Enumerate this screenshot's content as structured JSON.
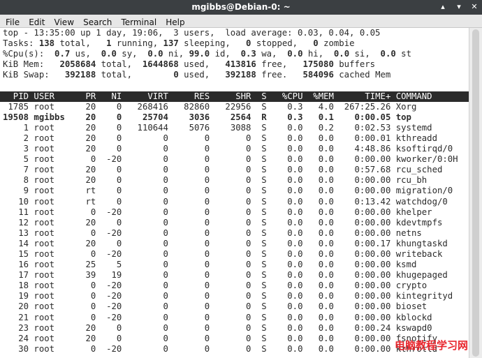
{
  "window": {
    "title": "mgibbs@Debian-0: ~",
    "buttons": {
      "minimize": "▴",
      "maximize": "▾",
      "close": "✕"
    }
  },
  "menu": [
    "File",
    "Edit",
    "View",
    "Search",
    "Terminal",
    "Help"
  ],
  "summary": {
    "top_line": "top - 13:35:00 up 1 day, 19:06,  3 users,  load average: 0.03, 0.04, 0.05",
    "tasks": [
      {
        "t": "Tasks: ",
        "b": false
      },
      {
        "t": "138",
        "b": true
      },
      {
        "t": " total,   ",
        "b": false
      },
      {
        "t": "1",
        "b": true
      },
      {
        "t": " running, ",
        "b": false
      },
      {
        "t": "137",
        "b": true
      },
      {
        "t": " sleeping,   ",
        "b": false
      },
      {
        "t": "0",
        "b": true
      },
      {
        "t": " stopped,   ",
        "b": false
      },
      {
        "t": "0",
        "b": true
      },
      {
        "t": " zombie",
        "b": false
      }
    ],
    "cpu": [
      {
        "t": "%Cpu(s):  ",
        "b": false
      },
      {
        "t": "0.7",
        "b": true
      },
      {
        "t": " us,  ",
        "b": false
      },
      {
        "t": "0.0",
        "b": true
      },
      {
        "t": " sy,  ",
        "b": false
      },
      {
        "t": "0.0",
        "b": true
      },
      {
        "t": " ni, ",
        "b": false
      },
      {
        "t": "99.0",
        "b": true
      },
      {
        "t": " id,  ",
        "b": false
      },
      {
        "t": "0.3",
        "b": true
      },
      {
        "t": " wa,  ",
        "b": false
      },
      {
        "t": "0.0",
        "b": true
      },
      {
        "t": " hi,  ",
        "b": false
      },
      {
        "t": "0.0",
        "b": true
      },
      {
        "t": " si,  ",
        "b": false
      },
      {
        "t": "0.0",
        "b": true
      },
      {
        "t": " st",
        "b": false
      }
    ],
    "mem": [
      {
        "t": "KiB Mem:   ",
        "b": false
      },
      {
        "t": "2058684",
        "b": true
      },
      {
        "t": " total,  ",
        "b": false
      },
      {
        "t": "1644868",
        "b": true
      },
      {
        "t": " used,   ",
        "b": false
      },
      {
        "t": "413816",
        "b": true
      },
      {
        "t": " free,   ",
        "b": false
      },
      {
        "t": "175080",
        "b": true
      },
      {
        "t": " buffers",
        "b": false
      }
    ],
    "swap": [
      {
        "t": "KiB Swap:   ",
        "b": false
      },
      {
        "t": "392188",
        "b": true
      },
      {
        "t": " total,        ",
        "b": false
      },
      {
        "t": "0",
        "b": true
      },
      {
        "t": " used,   ",
        "b": false
      },
      {
        "t": "392188",
        "b": true
      },
      {
        "t": " free.   ",
        "b": false
      },
      {
        "t": "584096",
        "b": true
      },
      {
        "t": " cached Mem",
        "b": false
      }
    ]
  },
  "columns": [
    "PID",
    "USER",
    "PR",
    "NI",
    "VIRT",
    "RES",
    "SHR",
    "S",
    "%CPU",
    "%MEM",
    "TIME+",
    "COMMAND"
  ],
  "processes": [
    {
      "pid": "1785",
      "user": "root",
      "pr": "20",
      "ni": "0",
      "virt": "268416",
      "res": "82860",
      "shr": "22956",
      "s": "S",
      "cpu": "0.3",
      "mem": "4.0",
      "time": "267:25.26",
      "cmd": "Xorg",
      "bold": false
    },
    {
      "pid": "19508",
      "user": "mgibbs",
      "pr": "20",
      "ni": "0",
      "virt": "25704",
      "res": "3036",
      "shr": "2564",
      "s": "R",
      "cpu": "0.3",
      "mem": "0.1",
      "time": "0:00.05",
      "cmd": "top",
      "bold": true
    },
    {
      "pid": "1",
      "user": "root",
      "pr": "20",
      "ni": "0",
      "virt": "110644",
      "res": "5076",
      "shr": "3088",
      "s": "S",
      "cpu": "0.0",
      "mem": "0.2",
      "time": "0:02.53",
      "cmd": "systemd",
      "bold": false
    },
    {
      "pid": "2",
      "user": "root",
      "pr": "20",
      "ni": "0",
      "virt": "0",
      "res": "0",
      "shr": "0",
      "s": "S",
      "cpu": "0.0",
      "mem": "0.0",
      "time": "0:00.01",
      "cmd": "kthreadd",
      "bold": false
    },
    {
      "pid": "3",
      "user": "root",
      "pr": "20",
      "ni": "0",
      "virt": "0",
      "res": "0",
      "shr": "0",
      "s": "S",
      "cpu": "0.0",
      "mem": "0.0",
      "time": "4:48.86",
      "cmd": "ksoftirqd/0",
      "bold": false
    },
    {
      "pid": "5",
      "user": "root",
      "pr": "0",
      "ni": "-20",
      "virt": "0",
      "res": "0",
      "shr": "0",
      "s": "S",
      "cpu": "0.0",
      "mem": "0.0",
      "time": "0:00.00",
      "cmd": "kworker/0:0H",
      "bold": false
    },
    {
      "pid": "7",
      "user": "root",
      "pr": "20",
      "ni": "0",
      "virt": "0",
      "res": "0",
      "shr": "0",
      "s": "S",
      "cpu": "0.0",
      "mem": "0.0",
      "time": "0:57.68",
      "cmd": "rcu_sched",
      "bold": false
    },
    {
      "pid": "8",
      "user": "root",
      "pr": "20",
      "ni": "0",
      "virt": "0",
      "res": "0",
      "shr": "0",
      "s": "S",
      "cpu": "0.0",
      "mem": "0.0",
      "time": "0:00.00",
      "cmd": "rcu_bh",
      "bold": false
    },
    {
      "pid": "9",
      "user": "root",
      "pr": "rt",
      "ni": "0",
      "virt": "0",
      "res": "0",
      "shr": "0",
      "s": "S",
      "cpu": "0.0",
      "mem": "0.0",
      "time": "0:00.00",
      "cmd": "migration/0",
      "bold": false
    },
    {
      "pid": "10",
      "user": "root",
      "pr": "rt",
      "ni": "0",
      "virt": "0",
      "res": "0",
      "shr": "0",
      "s": "S",
      "cpu": "0.0",
      "mem": "0.0",
      "time": "0:13.42",
      "cmd": "watchdog/0",
      "bold": false
    },
    {
      "pid": "11",
      "user": "root",
      "pr": "0",
      "ni": "-20",
      "virt": "0",
      "res": "0",
      "shr": "0",
      "s": "S",
      "cpu": "0.0",
      "mem": "0.0",
      "time": "0:00.00",
      "cmd": "khelper",
      "bold": false
    },
    {
      "pid": "12",
      "user": "root",
      "pr": "20",
      "ni": "0",
      "virt": "0",
      "res": "0",
      "shr": "0",
      "s": "S",
      "cpu": "0.0",
      "mem": "0.0",
      "time": "0:00.00",
      "cmd": "kdevtmpfs",
      "bold": false
    },
    {
      "pid": "13",
      "user": "root",
      "pr": "0",
      "ni": "-20",
      "virt": "0",
      "res": "0",
      "shr": "0",
      "s": "S",
      "cpu": "0.0",
      "mem": "0.0",
      "time": "0:00.00",
      "cmd": "netns",
      "bold": false
    },
    {
      "pid": "14",
      "user": "root",
      "pr": "20",
      "ni": "0",
      "virt": "0",
      "res": "0",
      "shr": "0",
      "s": "S",
      "cpu": "0.0",
      "mem": "0.0",
      "time": "0:00.17",
      "cmd": "khungtaskd",
      "bold": false
    },
    {
      "pid": "15",
      "user": "root",
      "pr": "0",
      "ni": "-20",
      "virt": "0",
      "res": "0",
      "shr": "0",
      "s": "S",
      "cpu": "0.0",
      "mem": "0.0",
      "time": "0:00.00",
      "cmd": "writeback",
      "bold": false
    },
    {
      "pid": "16",
      "user": "root",
      "pr": "25",
      "ni": "5",
      "virt": "0",
      "res": "0",
      "shr": "0",
      "s": "S",
      "cpu": "0.0",
      "mem": "0.0",
      "time": "0:00.00",
      "cmd": "ksmd",
      "bold": false
    },
    {
      "pid": "17",
      "user": "root",
      "pr": "39",
      "ni": "19",
      "virt": "0",
      "res": "0",
      "shr": "0",
      "s": "S",
      "cpu": "0.0",
      "mem": "0.0",
      "time": "0:00.00",
      "cmd": "khugepaged",
      "bold": false
    },
    {
      "pid": "18",
      "user": "root",
      "pr": "0",
      "ni": "-20",
      "virt": "0",
      "res": "0",
      "shr": "0",
      "s": "S",
      "cpu": "0.0",
      "mem": "0.0",
      "time": "0:00.00",
      "cmd": "crypto",
      "bold": false
    },
    {
      "pid": "19",
      "user": "root",
      "pr": "0",
      "ni": "-20",
      "virt": "0",
      "res": "0",
      "shr": "0",
      "s": "S",
      "cpu": "0.0",
      "mem": "0.0",
      "time": "0:00.00",
      "cmd": "kintegrityd",
      "bold": false
    },
    {
      "pid": "20",
      "user": "root",
      "pr": "0",
      "ni": "-20",
      "virt": "0",
      "res": "0",
      "shr": "0",
      "s": "S",
      "cpu": "0.0",
      "mem": "0.0",
      "time": "0:00.00",
      "cmd": "bioset",
      "bold": false
    },
    {
      "pid": "21",
      "user": "root",
      "pr": "0",
      "ni": "-20",
      "virt": "0",
      "res": "0",
      "shr": "0",
      "s": "S",
      "cpu": "0.0",
      "mem": "0.0",
      "time": "0:00.00",
      "cmd": "kblockd",
      "bold": false
    },
    {
      "pid": "23",
      "user": "root",
      "pr": "20",
      "ni": "0",
      "virt": "0",
      "res": "0",
      "shr": "0",
      "s": "S",
      "cpu": "0.0",
      "mem": "0.0",
      "time": "0:00.24",
      "cmd": "kswapd0",
      "bold": false
    },
    {
      "pid": "24",
      "user": "root",
      "pr": "20",
      "ni": "0",
      "virt": "0",
      "res": "0",
      "shr": "0",
      "s": "S",
      "cpu": "0.0",
      "mem": "0.0",
      "time": "0:00.00",
      "cmd": "fsnotify",
      "bold": false
    },
    {
      "pid": "30",
      "user": "root",
      "pr": "0",
      "ni": "-20",
      "virt": "0",
      "res": "0",
      "shr": "0",
      "s": "S",
      "cpu": "0.0",
      "mem": "0.0",
      "time": "0:00.00",
      "cmd": "kthrotld",
      "bold": false
    }
  ],
  "watermark": "电脑教程学习网",
  "colors": {
    "titlebar": "#3b3f42",
    "menubar": "#e7e7e7",
    "header_bg": "#2b2b2b",
    "text": "#2b2b2b",
    "watermark": "#e8262d"
  }
}
